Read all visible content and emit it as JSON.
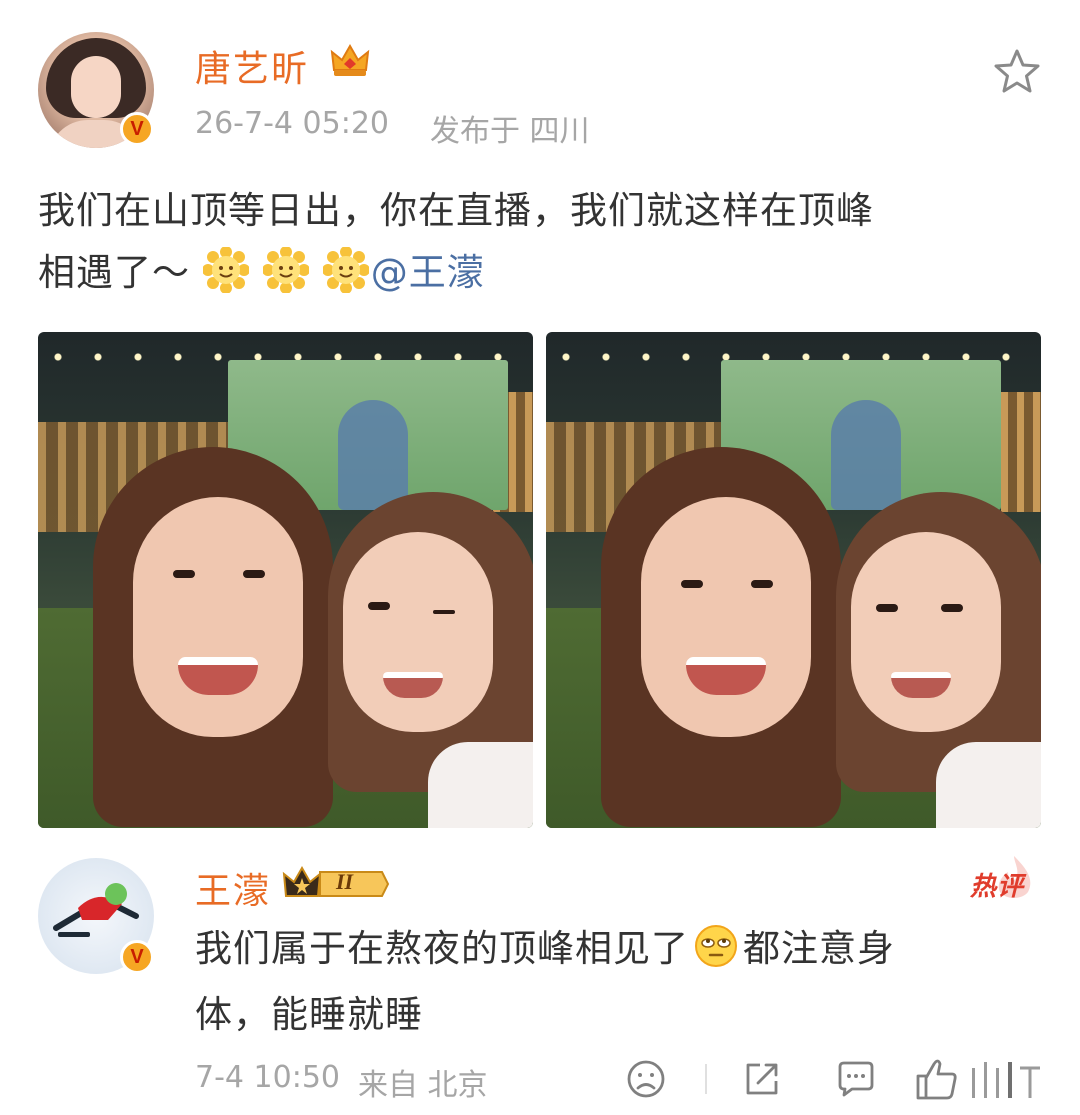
{
  "post": {
    "author": "唐艺昕",
    "time": "26-7-4 05:20",
    "location": "发布于 四川",
    "text_line1": "我们在山顶等日出，你在直播，我们就这样在顶峰",
    "text_line2": "相遇了～",
    "mention": "@王濛",
    "emojis": [
      "sun-smile-emoji",
      "sun-smile-emoji",
      "sun-smile-emoji"
    ],
    "verified_badge": "V",
    "photo_count": 2
  },
  "hot_comment": {
    "author": "王濛",
    "rank_label": "II",
    "hot_label": "热评",
    "text_line1": "我们属于在熬夜的顶峰相见了",
    "text_line1_after": "都注意身",
    "text_line2": "体，能睡就睡",
    "emoji": "eye-roll-emoji",
    "time": "7-4 10:50",
    "source": "来自 北京",
    "verified_badge": "V"
  },
  "colors": {
    "author": "#e86b25",
    "mention": "#4b6fa3",
    "meta": "#a6a6a6",
    "hot": "#e03c2c",
    "verified_bg": "#f6a623"
  },
  "icons": {
    "favorite": "star-outline-icon",
    "actions": [
      "dislike-face-icon",
      "share-icon",
      "comment-icon",
      "like-icon"
    ]
  }
}
